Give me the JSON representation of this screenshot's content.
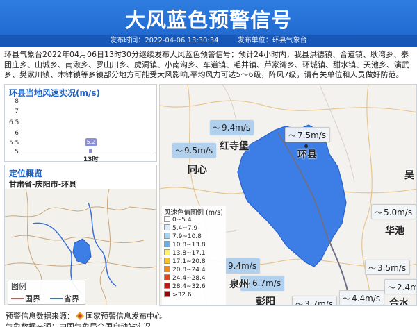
{
  "header": {
    "title": "大风蓝色预警信号",
    "publish_time": "发布时间：2022-04-06 13:30:34",
    "publisher": "发布单位：环县气象台"
  },
  "body": {
    "text": "环县气象台2022年04月06日13时30分继续发布大风蓝色预警信号：预计24小时内，我县洪德镇、合道镇、耿湾乡、秦团庄乡、山城乡、南湫乡、罗山川乡、虎洞镇、小南沟乡、车道镇、毛井镇、芦家湾乡、环城镇、甜水镇、天池乡、演武乡、樊家川镇、木钵镇等乡镇部分地方可能受大风影响,平均风力可达5～6级，阵风7级，请有关单位和人员做好防范。"
  },
  "wind_chart": {
    "title": "环县当地风速实况(m/s)",
    "yticks": [
      "8",
      "7",
      "6.5",
      "6",
      "5.5",
      "5"
    ],
    "chart_data": {
      "type": "bar",
      "categories": [
        "13时"
      ],
      "values": [
        5.2
      ],
      "value_labels": [
        "5.2"
      ],
      "title": "环县当地风速实况(m/s)",
      "ylim": [
        5,
        8
      ]
    }
  },
  "location": {
    "title": "定位概览",
    "name": "甘肃省-庆阳市-环县",
    "legend_title": "图例",
    "legend_items": [
      {
        "label": "国界",
        "color": "#c45a5a"
      },
      {
        "label": "省界",
        "color": "#3a6fd8"
      }
    ]
  },
  "map": {
    "legend_title": "风速色值图例 (m/s)",
    "speed_legend": [
      {
        "label": "0~5.4",
        "color": "#ffffff"
      },
      {
        "label": "5.4~7.9",
        "color": "#d9ecfa"
      },
      {
        "label": "7.9~10.8",
        "color": "#a8d4f3"
      },
      {
        "label": "10.8~13.8",
        "color": "#6ab0e8"
      },
      {
        "label": "13.8~17.1",
        "color": "#fff36b"
      },
      {
        "label": "17.1~20.8",
        "color": "#f7c02b"
      },
      {
        "label": "20.8~24.4",
        "color": "#f08a1f"
      },
      {
        "label": "24.4~28.4",
        "color": "#e0461c"
      },
      {
        "label": "28.4~32.6",
        "color": "#c01717"
      },
      {
        "label": ">32.6",
        "color": "#8a0a0a"
      }
    ],
    "wind_tags": [
      {
        "text": "9.4m/s"
      },
      {
        "text": "7.5m/s"
      },
      {
        "text": "9.5m/s"
      },
      {
        "text": "5.0m/s"
      },
      {
        "text": "3.5m/s"
      },
      {
        "text": "9.4m/s"
      },
      {
        "text": "6.7m/s"
      },
      {
        "text": "2.4m"
      },
      {
        "text": "4.4m/s"
      },
      {
        "text": "3.7m/s"
      }
    ],
    "towns": [
      "红寺堡",
      "环县",
      "同心",
      "华池",
      "彭阳",
      "合水",
      "吴",
      "泉州"
    ],
    "region_color": "#3d7ee6"
  },
  "footer": {
    "source_prefix": "预警信息数据来源：",
    "source_name": "国家预警信息发布中心",
    "weather_source": "气象数据来源：中国气象局全国自动站实况"
  }
}
